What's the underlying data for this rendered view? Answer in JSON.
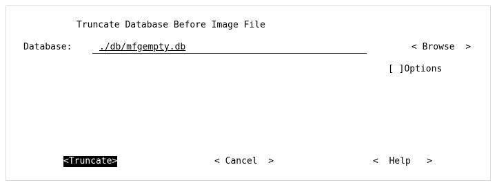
{
  "dialog": {
    "title": "Truncate Database Before Image File",
    "database_label": "Database:",
    "database_value": "./db/mfgempty.db",
    "browse_button": "< Browse  >",
    "options_checkbox": "[ ]Options"
  },
  "buttons": {
    "truncate": "<Truncate>",
    "cancel": "< Cancel  >",
    "help": "<  Help   >"
  }
}
